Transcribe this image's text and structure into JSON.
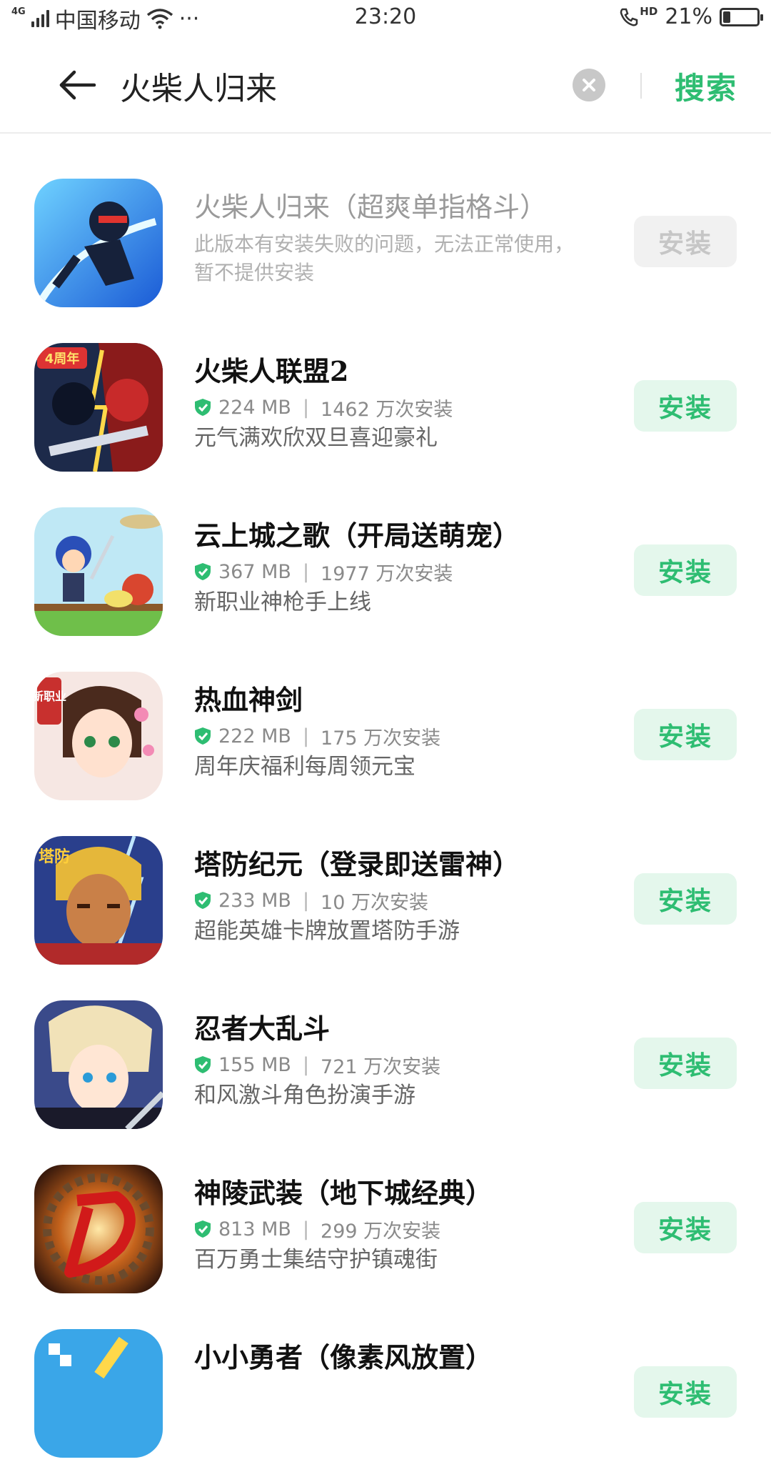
{
  "status_bar": {
    "network": "4G",
    "carrier": "中国移动",
    "more": "···",
    "time": "23:20",
    "call_badge": "HD",
    "battery": "21%",
    "battery_level": 0.21
  },
  "search": {
    "query": "火柴人归来",
    "button_label": "搜索"
  },
  "results": [
    {
      "name": "火柴人归来（超爽单指格斗）",
      "description": "此版本有安装失败的问题，无法正常使用，暂不提供安装",
      "button": "安装",
      "disabled": true,
      "icon": "ninja-stickman-icon"
    },
    {
      "name": "火柴人联盟2",
      "size": "224 MB",
      "installs": "1462 万次安装",
      "description": "元气满欢欣双旦喜迎豪礼",
      "button": "安装",
      "icon": "stickman-league-icon",
      "badge": "4周年"
    },
    {
      "name": "云上城之歌（开局送萌宠）",
      "size": "367 MB",
      "installs": "1977 万次安装",
      "description": "新职业神枪手上线",
      "button": "安装",
      "icon": "cloud-city-icon"
    },
    {
      "name": "热血神剑",
      "size": "222 MB",
      "installs": "175 万次安装",
      "description": "周年庆福利每周领元宝",
      "button": "安装",
      "icon": "sword-girl-icon",
      "badge": "新职业"
    },
    {
      "name": "塔防纪元（登录即送雷神）",
      "size": "233 MB",
      "installs": "10 万次安装",
      "description": "超能英雄卡牌放置塔防手游",
      "button": "安装",
      "icon": "thunder-hero-icon",
      "badge": "塔防"
    },
    {
      "name": "忍者大乱斗",
      "size": "155 MB",
      "installs": "721 万次安装",
      "description": "和风激斗角色扮演手游",
      "button": "安装",
      "icon": "ninja-boy-icon"
    },
    {
      "name": "神陵武装（地下城经典）",
      "size": "813 MB",
      "installs": "299 万次安装",
      "description": "百万勇士集结守护镇魂街",
      "button": "安装",
      "icon": "dungeon-d-icon"
    },
    {
      "name": "小小勇者（像素风放置）",
      "button": "安装",
      "icon": "pixel-hero-icon"
    }
  ],
  "colors": {
    "accent": "#2ebd72",
    "button_bg": "#e4f7ec",
    "disabled_bg": "#f1f1f1"
  }
}
